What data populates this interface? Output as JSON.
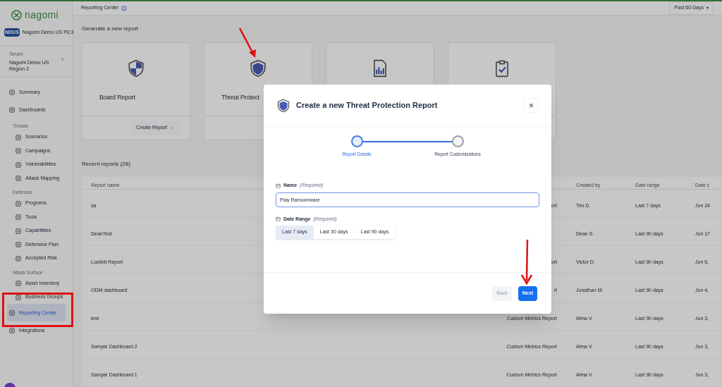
{
  "sidebar": {
    "brand": "nagomi",
    "org": {
      "badge": "NDUS",
      "name": "Nagomi Demo US Pi▯3"
    },
    "tenant": {
      "label": "Tenant",
      "name": "Nagomi Demo US Region 2",
      "chevron": "›"
    },
    "nav": [
      {
        "kind": "item",
        "label": "Summary",
        "selected": false
      },
      {
        "kind": "item",
        "label": "Dashboards",
        "selected": false
      },
      {
        "kind": "section",
        "label": "Threats",
        "children": [
          {
            "label": "Scenarios",
            "selected": false
          },
          {
            "label": "Campaigns",
            "selected": false
          },
          {
            "label": "Vulnerabilities",
            "selected": false
          },
          {
            "label": "Attack Mapping",
            "selected": false
          }
        ]
      },
      {
        "kind": "section",
        "label": "Defenses",
        "children": [
          {
            "label": "Programs",
            "selected": false
          },
          {
            "label": "Tools",
            "selected": false
          },
          {
            "label": "Capabilities",
            "selected": false
          },
          {
            "label": "Defensive Plan",
            "selected": false
          },
          {
            "label": "Accepted Risk",
            "selected": false
          }
        ]
      },
      {
        "kind": "section",
        "label": "Attack Surface",
        "children": [
          {
            "label": "Asset Inventory",
            "selected": false
          },
          {
            "label": "Business Groups",
            "selected": false
          }
        ]
      },
      {
        "kind": "item",
        "label": "Reporting Center",
        "selected": true
      },
      {
        "kind": "item",
        "label": "Integrations",
        "selected": false
      }
    ]
  },
  "header": {
    "title": "Reporting Center",
    "period": "Past 60 Days",
    "caret": "▾"
  },
  "generate": {
    "heading": "Generate a new report",
    "cards": [
      {
        "kind": "board",
        "title": "Board Report",
        "button": "Create Report",
        "arrow": "→"
      },
      {
        "kind": "threat",
        "title": "Threat Protect"
      },
      {
        "kind": "metrics"
      },
      {
        "kind": "checklist"
      }
    ]
  },
  "recent": {
    "heading": "Recent reports (28)",
    "columns": [
      "Report name",
      "",
      "Created by",
      "Date range",
      "Date c"
    ],
    "rows": [
      [
        "sa",
        "ort",
        "Tim D.",
        "Last 7 days",
        "Jun 24"
      ],
      [
        "DeanTest",
        "",
        "Dean S.",
        "Last 90 days",
        "Jun 17"
      ],
      [
        "Lockbit Report",
        "ort",
        "Victor D.",
        "Last 90 days",
        "Jun 6,"
      ],
      [
        "ODM dashboard",
        "rt",
        "Jonathan M.",
        "Last 90 days",
        "Jun 4,"
      ],
      [
        "test",
        "Custom Metrics Report",
        "Alma V.",
        "Last 90 days",
        "Jun 3,"
      ],
      [
        "Sample Dashboard 2",
        "Custom Metrics Report",
        "Alma V.",
        "Last 90 days",
        "Jun 3,"
      ],
      [
        "Sample Dashboard 1",
        "Custom Metrics Report",
        "Alma V.",
        "Last 90 days",
        "Jun 3,"
      ]
    ]
  },
  "modal": {
    "title": "Create a new Threat Protection Report",
    "close": "×",
    "steps": [
      {
        "label": "Report Details",
        "selected": true
      },
      {
        "label": "Report Customizations",
        "selected": false
      }
    ],
    "name": {
      "label": "Name",
      "hint": "(Required)",
      "value": "Play Ransomware"
    },
    "date_range": {
      "label": "Date Range",
      "hint": "(Required)",
      "options": [
        {
          "label": "Last 7 days",
          "selected": true
        },
        {
          "label": "Last 30 days",
          "selected": false
        },
        {
          "label": "Last 90 days",
          "selected": false
        }
      ]
    },
    "back": "Back",
    "next": "Next"
  }
}
